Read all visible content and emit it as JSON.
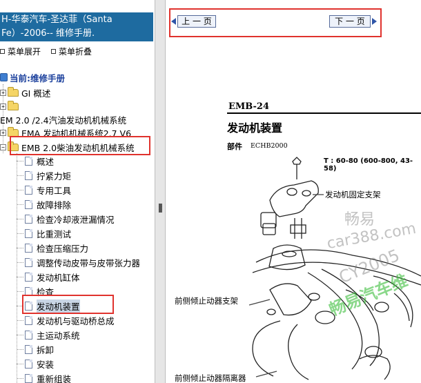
{
  "sidebar": {
    "title_line1": "H-华泰汽车-圣达菲（Santa",
    "title_line2": "Fe）-2006-- 维修手册.",
    "expand_label": "菜单展开",
    "collapse_label": "菜单折叠",
    "current_label": "当前:维修手册",
    "tree": {
      "gi": "GI 概述",
      "emp_engine": "EM 2.0 /2.4汽油发动机机械系统",
      "ema": "EMA 发动机机械系统2.7 V6",
      "emb": "EMB 2.0柴油发动机机械系统",
      "items": [
        "概述",
        "拧紧力矩",
        "专用工具",
        "故障排除",
        "检查冷却液泄漏情况",
        "比重测试",
        "检查压缩压力",
        "调整传动皮带与皮带张力器",
        "发动机缸体",
        "检查",
        "发动机装置",
        "发动机与驱动桥总成",
        "主运动系统",
        "拆卸",
        "安装",
        "重新组装"
      ]
    }
  },
  "nav": {
    "prev_label": "上 一 页",
    "next_label": "下 一 页"
  },
  "document": {
    "code": "EMB-24",
    "title": "发动机装置",
    "parts_label": "部件",
    "parts_code": "ECHB2000",
    "torque": "T : 60-80 (600-800, 43-58)",
    "label_mount": "发动机固定支架",
    "label_front_bracket": "前侧倾止动器支架",
    "label_front_insulator": "前侧倾止动器隔离器"
  },
  "watermark": {
    "line1": "畅易",
    "line2": "car388.com",
    "line3": "CY2005",
    "line4": "畅易汽车维"
  },
  "colors": {
    "title_bar": "#1e6ba0",
    "highlight_box": "#e0322d",
    "selection": "#c9d6e6"
  }
}
